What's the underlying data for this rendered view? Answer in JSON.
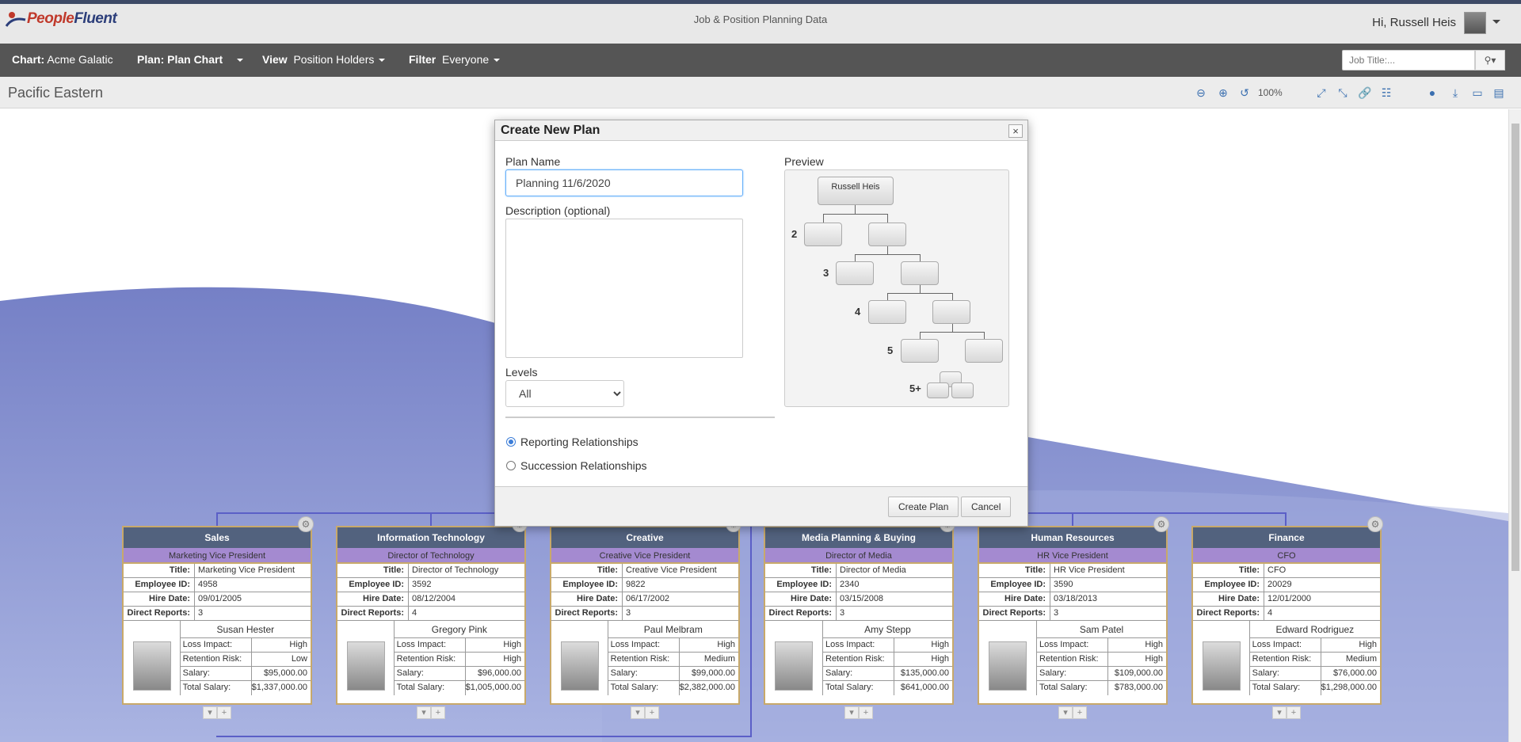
{
  "header": {
    "logo_text_a": "People",
    "logo_text_b": "Fluent",
    "app_title": "Job & Position Planning Data",
    "greeting": "Hi, Russell Heis"
  },
  "nav": {
    "chart_label": "Chart:",
    "chart_value": "Acme Galatic",
    "plan_label": "Plan: Plan Chart",
    "view_label": "View",
    "view_value": "Position Holders",
    "filter_label": "Filter",
    "filter_value": "Everyone",
    "job_search_placeholder": "Job Title:..."
  },
  "toolbar": {
    "page_title": "Pacific Eastern",
    "zoom": "100%"
  },
  "modal": {
    "title": "Create New Plan",
    "close": "×",
    "plan_name_label": "Plan Name",
    "plan_name_value": "Planning 11/6/2020",
    "description_label": "Description (optional)",
    "levels_label": "Levels",
    "levels_value": "All",
    "radio_reporting": "Reporting Relationships",
    "radio_succession": "Succession Relationships",
    "preview_label": "Preview",
    "preview_root": "Russell Heis",
    "preview_levels": [
      "2",
      "3",
      "4",
      "5",
      "5+"
    ],
    "create_button": "Create Plan",
    "cancel_button": "Cancel"
  },
  "field_labels": {
    "title": "Title:",
    "employee_id": "Employee ID:",
    "hire_date": "Hire Date:",
    "direct_reports": "Direct Reports:",
    "loss_impact": "Loss Impact:",
    "retention_risk": "Retention Risk:",
    "salary": "Salary:",
    "total_salary": "Total Salary:"
  },
  "cards": [
    {
      "dept": "Sales",
      "position": "Marketing Vice President",
      "title": "Marketing Vice President",
      "employee_id": "4958",
      "hire_date": "09/01/2005",
      "direct_reports": "3",
      "name": "Susan Hester",
      "loss_impact": "High",
      "retention_risk": "Low",
      "salary": "$95,000.00",
      "total_salary": "$1,337,000.00"
    },
    {
      "dept": "Information Technology",
      "position": "Director of Technology",
      "title": "Director of Technology",
      "employee_id": "3592",
      "hire_date": "08/12/2004",
      "direct_reports": "4",
      "name": "Gregory Pink",
      "loss_impact": "High",
      "retention_risk": "High",
      "salary": "$96,000.00",
      "total_salary": "$1,005,000.00"
    },
    {
      "dept": "Creative",
      "position": "Creative Vice President",
      "title": "Creative Vice President",
      "employee_id": "9822",
      "hire_date": "06/17/2002",
      "direct_reports": "3",
      "name": "Paul Melbram",
      "loss_impact": "High",
      "retention_risk": "Medium",
      "salary": "$99,000.00",
      "total_salary": "$2,382,000.00"
    },
    {
      "dept": "Media Planning & Buying",
      "position": "Director of Media",
      "title": "Director of Media",
      "employee_id": "2340",
      "hire_date": "03/15/2008",
      "direct_reports": "3",
      "name": "Amy Stepp",
      "loss_impact": "High",
      "retention_risk": "High",
      "salary": "$135,000.00",
      "total_salary": "$641,000.00"
    },
    {
      "dept": "Human Resources",
      "position": "HR Vice President",
      "title": "HR Vice President",
      "employee_id": "3590",
      "hire_date": "03/18/2013",
      "direct_reports": "3",
      "name": "Sam Patel",
      "loss_impact": "High",
      "retention_risk": "High",
      "salary": "$109,000.00",
      "total_salary": "$783,000.00"
    },
    {
      "dept": "Finance",
      "position": "CFO",
      "title": "CFO",
      "employee_id": "20029",
      "hire_date": "12/01/2000",
      "direct_reports": "4",
      "name": "Edward Rodriguez",
      "loss_impact": "High",
      "retention_risk": "Medium",
      "salary": "$76,000.00",
      "total_salary": "$1,298,000.00"
    }
  ],
  "colors": {
    "nav_bg": "#555555",
    "card_header": "#52627e",
    "card_subheader": "#a48ad0",
    "card_border": "#c8a96a",
    "background_wave": "#7b87c9"
  },
  "icons": [
    "zoom-out-icon",
    "zoom-in-icon",
    "reset-zoom-icon",
    "expand-icon",
    "collapse-icon",
    "link-icon",
    "hierarchy-icon",
    "camera-icon",
    "download-icon",
    "pdf-icon",
    "export-icon"
  ]
}
